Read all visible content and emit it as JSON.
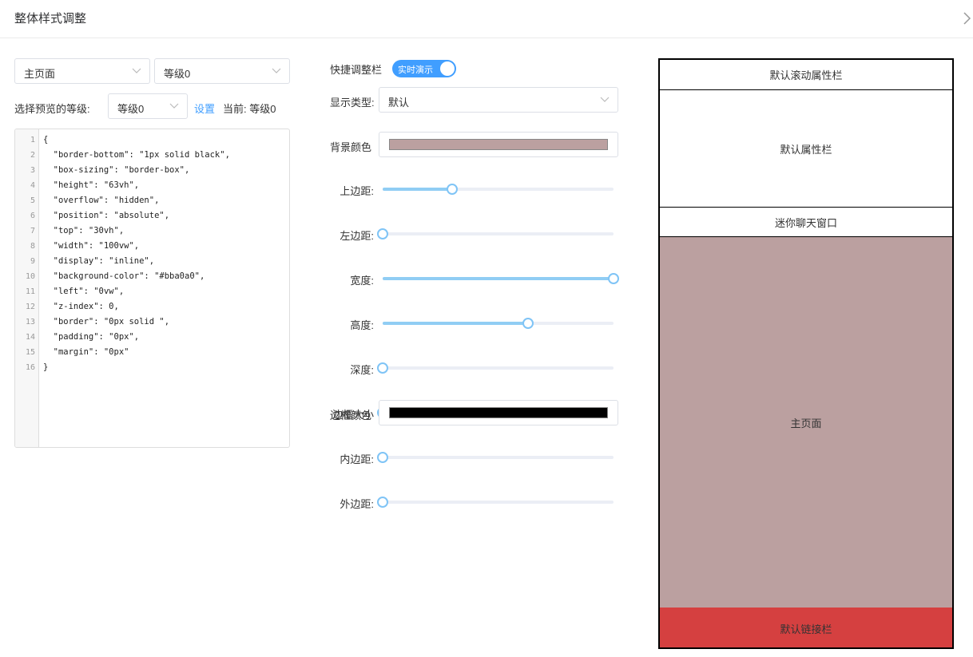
{
  "header": {
    "title": "整体样式调整",
    "chevron_icon": "chevron-right-icon"
  },
  "left": {
    "page_select": {
      "value": "主页面"
    },
    "level_select": {
      "value": "等级0"
    },
    "preview_level_label": "选择预览的等级:",
    "preview_level_select": {
      "value": "等级0"
    },
    "set_link": "设置",
    "current_label": "当前: 等级0",
    "code_lines": [
      "{",
      "  \"border-bottom\": \"1px solid black\",",
      "  \"box-sizing\": \"border-box\",",
      "  \"height\": \"63vh\",",
      "  \"overflow\": \"hidden\",",
      "  \"position\": \"absolute\",",
      "  \"top\": \"30vh\",",
      "  \"width\": \"100vw\",",
      "  \"display\": \"inline\",",
      "  \"background-color\": \"#bba0a0\",",
      "  \"left\": \"0vw\",",
      "  \"z-index\": 0,",
      "  \"border\": \"0px solid \",",
      "  \"padding\": \"0px\",",
      "  \"margin\": \"0px\"",
      "}"
    ]
  },
  "middle": {
    "quick_label": "快捷调整栏",
    "toggle_text": "实时演示",
    "toggle_on": true,
    "display_type_label": "显示类型:",
    "display_type_value": "默认",
    "bg_color_label": "背景颜色",
    "bg_color": "#bba0a0",
    "border_color_label": "边框颜色",
    "border_color": "#000000",
    "accent_color": "#409eff",
    "sliders": [
      {
        "label": "上边距:",
        "value": 0.3
      },
      {
        "label": "左边距:",
        "value": 0.0
      },
      {
        "label": "宽度:",
        "value": 1.0
      },
      {
        "label": "高度:",
        "value": 0.63
      },
      {
        "label": "深度:",
        "value": 0.0
      },
      {
        "label": "边框大小",
        "value": 0.0
      },
      {
        "label": "内边距:",
        "value": 0.0
      },
      {
        "label": "外边距:",
        "value": 0.0
      }
    ]
  },
  "preview": {
    "scroll_bar": "默认滚动属性栏",
    "attr_bar": "默认属性栏",
    "mini_chat": "迷你聊天窗口",
    "main_page": "主页面",
    "main_page_color": "#bba0a0",
    "link_bar": "默认链接栏",
    "link_bar_color": "#d54040"
  }
}
